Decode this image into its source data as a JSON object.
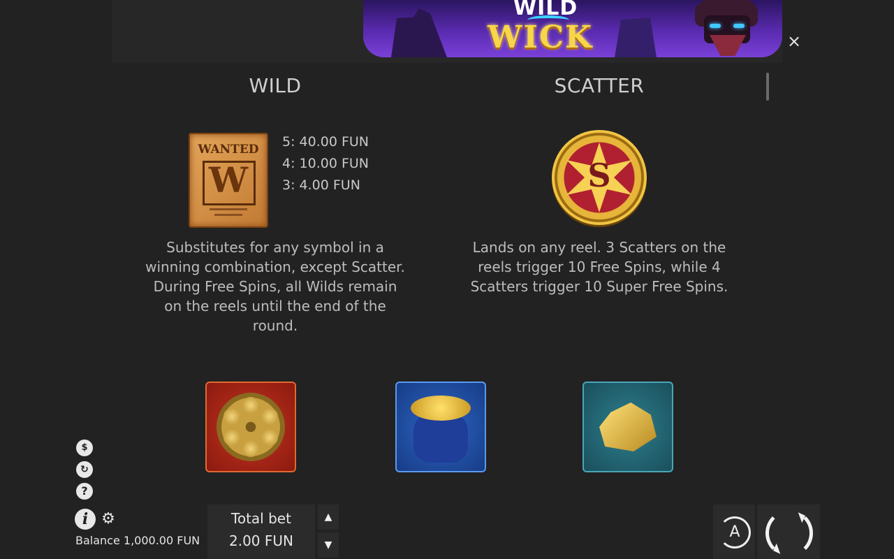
{
  "banner": {
    "logo_line1": "WILD",
    "logo_line2": "WICK"
  },
  "close_label": "×",
  "wild": {
    "title": "WILD",
    "symbol_text": "WANTED",
    "symbol_letter": "W",
    "payouts": [
      "5:  40.00 FUN",
      "4:  10.00 FUN",
      "3:  4.00 FUN"
    ],
    "description": "Substitutes for any symbol in a winning combination, except Scatter. During Free Spins, all Wilds remain on the reels until the end of the round."
  },
  "scatter": {
    "title": "SCATTER",
    "symbol_letter": "S",
    "description": "Lands on any reel. 3 Scatters on the reels trigger 10 Free Spins, while 4 Scatters trigger 10 Super Free Spins."
  },
  "tiles": [
    "revolver-cylinder",
    "coin-bag",
    "gold-nugget"
  ],
  "side_icons": [
    "coin-bag-icon",
    "history-icon",
    "help-icon"
  ],
  "footer": {
    "info_icon": "i",
    "help_icon": "?",
    "balance_label": "Balance 1,000.00 FUN",
    "bet_label": "Total bet",
    "bet_value": "2.00 FUN",
    "autoplay_letter": "A"
  },
  "colors": {
    "background": "#222222",
    "text": "#c9c9c9",
    "panel": "#2b2b2b"
  }
}
